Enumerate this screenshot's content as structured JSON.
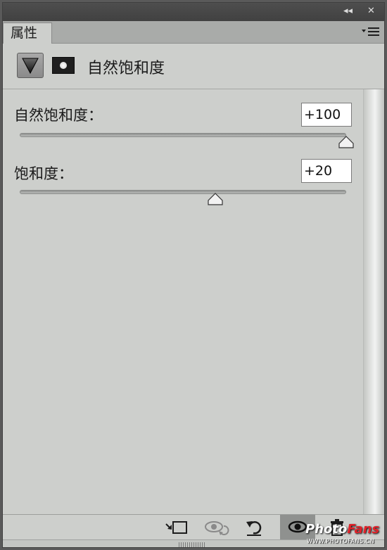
{
  "titlebar": {
    "collapse_glyph": "◂◂",
    "close_glyph": "✕"
  },
  "tab": {
    "label": "属性"
  },
  "header": {
    "title": "自然饱和度",
    "adjustment_icon": "vibrance-triangle-icon",
    "mask_icon": "layer-mask-icon"
  },
  "controls": [
    {
      "label": "自然饱和度：",
      "value": "+100",
      "level_fraction": 1.0
    },
    {
      "label": "饱和度：",
      "value": "+20",
      "level_fraction": 0.6
    }
  ],
  "bottom_toolbar": {
    "icons": [
      "clip-to-layer-icon",
      "view-previous-state-icon",
      "reset-icon",
      "visibility-eye-icon",
      "trash-icon"
    ]
  },
  "watermark": {
    "brand_white": "Photo",
    "brand_red": "Fans",
    "url": "WWW.PHOTOFANS.CN"
  },
  "colors": {
    "panel_bg": "#cdcfcc",
    "titlebar_bg": "#464646",
    "brand_red": "#e0232a"
  }
}
